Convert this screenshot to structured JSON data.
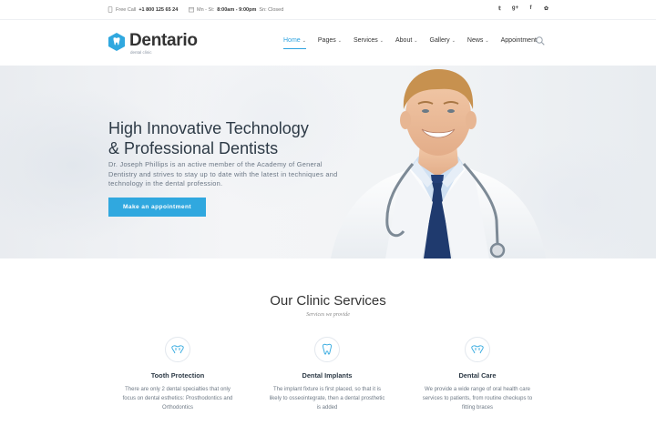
{
  "topbar": {
    "phone_prefix": "Free Call",
    "phone_number": "+1 800 125 65 24",
    "hours_prefix": "Mn - St:",
    "hours_value": "8:00am - 9:00pm",
    "hours_suffix": "Sn: Closed",
    "socials": [
      "twitter",
      "google-plus",
      "facebook",
      "foursquare"
    ],
    "social_glyphs": [
      "𝕥",
      "g+",
      "f",
      "✿"
    ]
  },
  "logo": {
    "name": "Dentario",
    "tagline": "dental clinic"
  },
  "nav": {
    "items": [
      {
        "label": "Home",
        "has_dropdown": true,
        "active": true
      },
      {
        "label": "Pages",
        "has_dropdown": true
      },
      {
        "label": "Services",
        "has_dropdown": true
      },
      {
        "label": "About",
        "has_dropdown": true
      },
      {
        "label": "Gallery",
        "has_dropdown": true
      },
      {
        "label": "News",
        "has_dropdown": true
      },
      {
        "label": "Appointment",
        "has_dropdown": false
      }
    ],
    "search_icon": "search-icon",
    "caret": "⌄"
  },
  "hero": {
    "title_line1": "High Innovative Technology",
    "title_line2": "& Professional Dentists",
    "description": "Dr. Joseph Phillips is an active member of the Academy of General Dentistry and strives to stay up to date with the latest in techniques and technology in the dental profession.",
    "button_label": "Make an appointment"
  },
  "services": {
    "title": "Our Clinic Services",
    "subtitle": "Services we provide",
    "cards": [
      {
        "title": "Tooth Protection",
        "text": "There are only 2 dental specialties that only focus on dental esthetics: Prosthodontics and Orthodontics",
        "icon": "teeth-icon"
      },
      {
        "title": "Dental Implants",
        "text": "The implant fixture is first placed, so that it is likely to osseointegrate, then a dental prosthetic is added",
        "icon": "tooth-icon"
      },
      {
        "title": "Dental Care",
        "text": "We provide a wide range of oral health care services to patients, from routine checkups to fitting braces",
        "icon": "teeth-icon"
      }
    ]
  },
  "colors": {
    "accent": "#30a8df",
    "text_dark": "#2d3a46",
    "text_muted": "#6f7a86"
  }
}
